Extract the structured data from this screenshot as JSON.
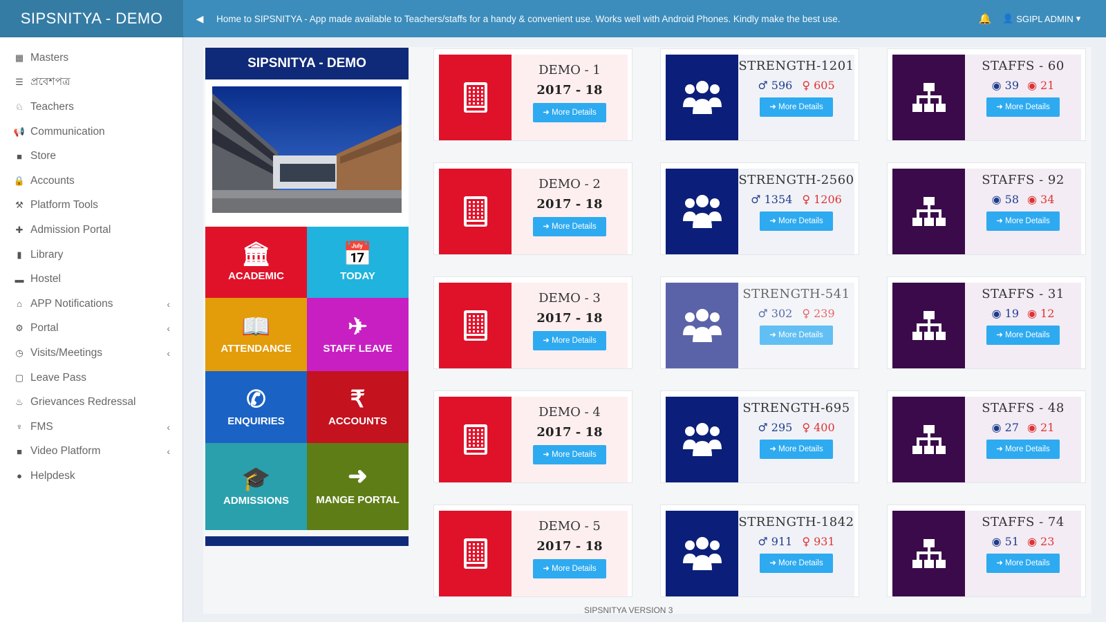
{
  "header": {
    "brand": "SIPSNITYA - DEMO",
    "marquee": "Home to SIPSNITYA - App made available to Teachers/staffs for a handy & convenient use. Works well with Android Phones. Kindly make the best use.",
    "user": "SGIPL ADMIN"
  },
  "sidebar": {
    "items": [
      {
        "label": "Masters",
        "icon": "grid-icon",
        "glyph": "▦",
        "has_arrow": false
      },
      {
        "label": "প্রবেশপত্র",
        "icon": "list-icon",
        "glyph": "☰",
        "has_arrow": false
      },
      {
        "label": "Teachers",
        "icon": "teacher-icon",
        "glyph": "♘",
        "has_arrow": false
      },
      {
        "label": "Communication",
        "icon": "megaphone-icon",
        "glyph": "📢",
        "has_arrow": false
      },
      {
        "label": "Store",
        "icon": "store-icon",
        "glyph": "■",
        "has_arrow": false
      },
      {
        "label": "Accounts",
        "icon": "lock-icon",
        "glyph": "🔒",
        "has_arrow": false
      },
      {
        "label": "Platform Tools",
        "icon": "tools-icon",
        "glyph": "⚒",
        "has_arrow": false
      },
      {
        "label": "Admission Portal",
        "icon": "plus-icon",
        "glyph": "✚",
        "has_arrow": false
      },
      {
        "label": "Library",
        "icon": "book-icon",
        "glyph": "▮",
        "has_arrow": false
      },
      {
        "label": "Hostel",
        "icon": "bed-icon",
        "glyph": "▬",
        "has_arrow": false
      },
      {
        "label": "APP Notifications",
        "icon": "app-icon",
        "glyph": "⌂",
        "has_arrow": true
      },
      {
        "label": "Portal",
        "icon": "portal-icon",
        "glyph": "⚙",
        "has_arrow": true
      },
      {
        "label": "Visits/Meetings",
        "icon": "clock-icon",
        "glyph": "◷",
        "has_arrow": true
      },
      {
        "label": "Leave Pass",
        "icon": "file-icon",
        "glyph": "▢",
        "has_arrow": false
      },
      {
        "label": "Grievances Redressal",
        "icon": "fire-icon",
        "glyph": "♨",
        "has_arrow": false
      },
      {
        "label": "FMS",
        "icon": "trophy-icon",
        "glyph": "♆",
        "has_arrow": true
      },
      {
        "label": "Video Platform",
        "icon": "video-icon",
        "glyph": "■",
        "has_arrow": true
      },
      {
        "label": "Helpdesk",
        "icon": "helpdesk-icon",
        "glyph": "●",
        "has_arrow": false
      }
    ]
  },
  "panel": {
    "title": "SIPSNITYA - DEMO",
    "tiles": [
      {
        "label": "ACADEMIC",
        "icon": "bank-icon",
        "glyph": "🏛",
        "color": "#e0122a"
      },
      {
        "label": "TODAY",
        "icon": "calendar-icon",
        "glyph": "📅",
        "color": "#1fb3de"
      },
      {
        "label": "ATTENDANCE",
        "icon": "book-icon",
        "glyph": "📖",
        "color": "#e39c0a"
      },
      {
        "label": "STAFF LEAVE",
        "icon": "paper-plane-icon",
        "glyph": "✈",
        "color": "#c81fc3"
      },
      {
        "label": "ENQUIRIES",
        "icon": "phone-icon",
        "glyph": "✆",
        "color": "#1a62c4"
      },
      {
        "label": "ACCOUNTS",
        "icon": "rupee-icon",
        "glyph": "₹",
        "color": "#c4121f"
      },
      {
        "label": "ADMISSIONS",
        "icon": "graduation-cap-icon",
        "glyph": "🎓",
        "color": "#2aa0ad"
      },
      {
        "label": "MANGE PORTAL",
        "icon": "sign-in-icon",
        "glyph": "➜",
        "color": "#5f7d17"
      }
    ]
  },
  "more_label": "More Details",
  "schools": [
    {
      "name": "DEMO - 1",
      "year": "2017 - 18"
    },
    {
      "name": "DEMO - 2",
      "year": "2017 - 18"
    },
    {
      "name": "DEMO - 3",
      "year": "2017 - 18"
    },
    {
      "name": "DEMO - 4",
      "year": "2017 - 18"
    },
    {
      "name": "DEMO - 5",
      "year": "2017 - 18"
    }
  ],
  "strengths": [
    {
      "label": "STRENGTH-1201",
      "boys": "596",
      "girls": "605"
    },
    {
      "label": "STRENGTH-2560",
      "boys": "1354",
      "girls": "1206"
    },
    {
      "label": "STRENGTH-541",
      "boys": "302",
      "girls": "239"
    },
    {
      "label": "STRENGTH-695",
      "boys": "295",
      "girls": "400"
    },
    {
      "label": "STRENGTH-1842",
      "boys": "911",
      "girls": "931"
    }
  ],
  "staffs": [
    {
      "label": "STAFFS - 60",
      "male": "39",
      "female": "21"
    },
    {
      "label": "STAFFS - 92",
      "male": "58",
      "female": "34"
    },
    {
      "label": "STAFFS - 31",
      "male": "19",
      "female": "12"
    },
    {
      "label": "STAFFS - 48",
      "male": "27",
      "female": "21"
    },
    {
      "label": "STAFFS - 74",
      "male": "51",
      "female": "23"
    }
  ],
  "colors": {
    "school_tile": "#e0122a",
    "school_bg": "#fdeff0",
    "strength_tile": "#0b1f7a",
    "strength_tile_faded": "#5b63a8",
    "strength_bg": "#f1f2f7",
    "staff_tile": "#3a0a4a",
    "staff_bg": "#f3ecf4"
  },
  "footer": "SIPSNITYA VERSION 3"
}
